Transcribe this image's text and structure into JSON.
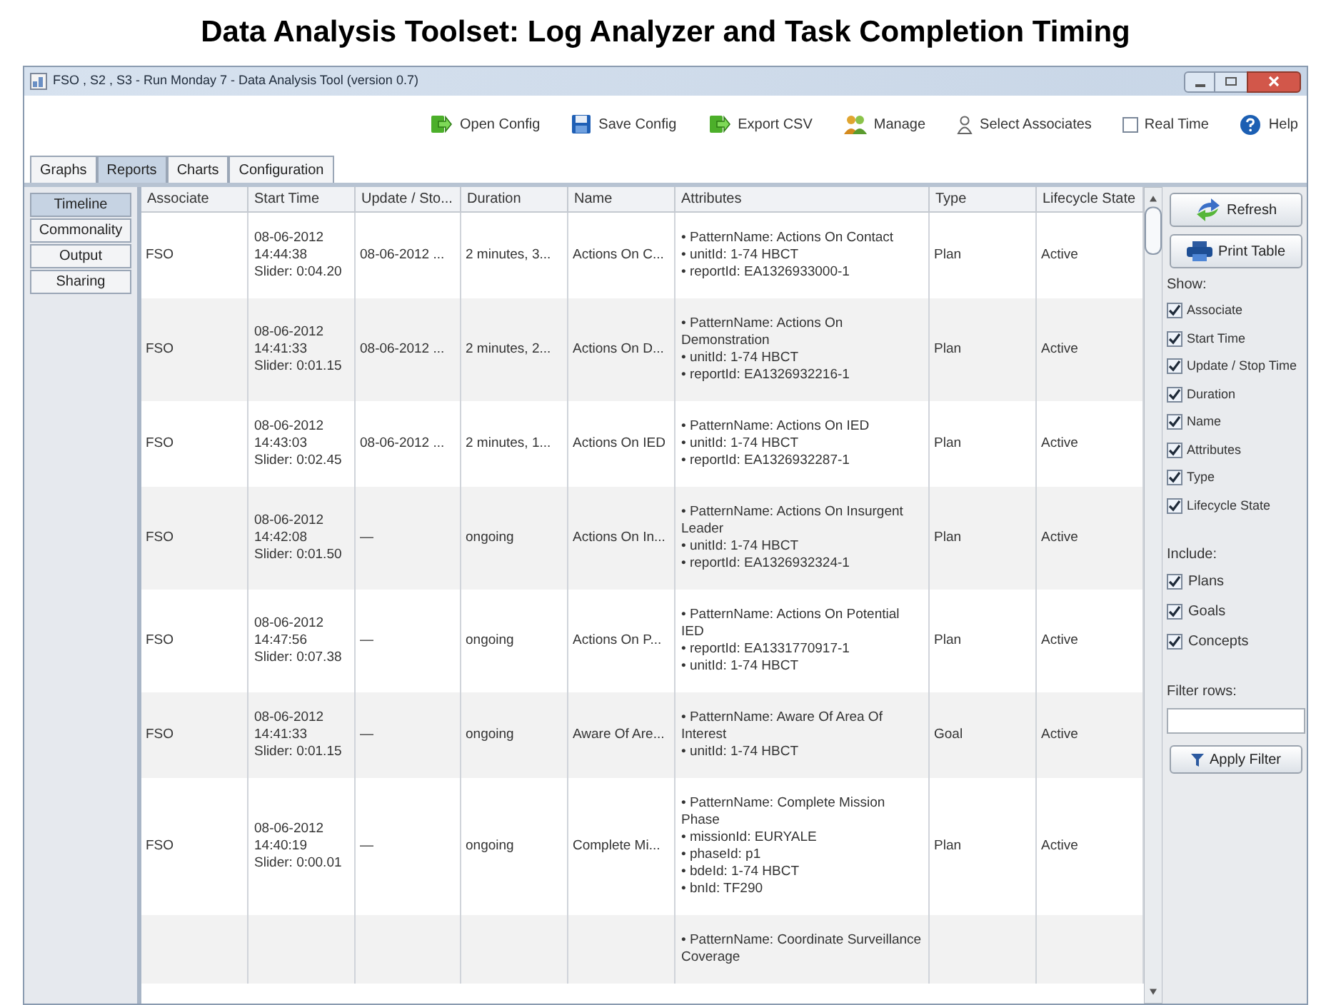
{
  "page_title": "Data Analysis Toolset: Log Analyzer and Task Completion Timing",
  "window": {
    "title": "FSO , S2 , S3 - Run Monday 7 - Data Analysis Tool (version 0.7)"
  },
  "toolbar": [
    {
      "kind": "open",
      "label": "Open Config"
    },
    {
      "kind": "save",
      "label": "Save Config"
    },
    {
      "kind": "export",
      "label": "Export CSV"
    },
    {
      "kind": "manage",
      "label": "Manage"
    },
    {
      "kind": "associates",
      "label": "Select Associates"
    },
    {
      "kind": "checkbox",
      "label": "Real Time",
      "checked": false
    },
    {
      "kind": "help",
      "label": "Help"
    }
  ],
  "tabs": [
    {
      "label": "Graphs",
      "selected": false
    },
    {
      "label": "Reports",
      "selected": true
    },
    {
      "label": "Charts",
      "selected": false
    },
    {
      "label": "Configuration",
      "selected": false
    }
  ],
  "side_tabs": [
    {
      "label": "Timeline",
      "selected": true
    },
    {
      "label": "Commonality",
      "selected": false
    },
    {
      "label": "Output",
      "selected": false
    },
    {
      "label": "Sharing",
      "selected": false
    }
  ],
  "table": {
    "columns": [
      "Associate",
      "Start Time",
      "Update / Sto...",
      "Duration",
      "Name",
      "Attributes",
      "Type",
      "Lifecycle State"
    ],
    "rows": [
      {
        "associate": "FSO",
        "start_time": [
          "08-06-2012",
          "14:44:38",
          "Slider: 0:04.20"
        ],
        "update": "08-06-2012 ...",
        "duration": "2 minutes, 3...",
        "name": "Actions On C...",
        "attributes": [
          "• PatternName: Actions On Contact",
          "• unitId: 1-74 HBCT",
          "• reportId: EA1326933000-1"
        ],
        "type": "Plan",
        "state": "Active"
      },
      {
        "associate": "FSO",
        "start_time": [
          "08-06-2012",
          "14:41:33",
          "Slider: 0:01.15"
        ],
        "update": "08-06-2012 ...",
        "duration": "2 minutes, 2...",
        "name": "Actions On D...",
        "attributes": [
          "• PatternName: Actions On Demonstration",
          "• unitId: 1-74 HBCT",
          "• reportId: EA1326932216-1"
        ],
        "type": "Plan",
        "state": "Active"
      },
      {
        "associate": "FSO",
        "start_time": [
          "08-06-2012",
          "14:43:03",
          "Slider: 0:02.45"
        ],
        "update": "08-06-2012 ...",
        "duration": "2 minutes, 1...",
        "name": "Actions On IED",
        "attributes": [
          "• PatternName: Actions On IED",
          "• unitId: 1-74 HBCT",
          "• reportId: EA1326932287-1"
        ],
        "type": "Plan",
        "state": "Active"
      },
      {
        "associate": "FSO",
        "start_time": [
          "08-06-2012",
          "14:42:08",
          "Slider: 0:01.50"
        ],
        "update": "—",
        "duration": "ongoing",
        "name": "Actions On In...",
        "attributes": [
          "• PatternName: Actions On Insurgent Leader",
          "• unitId: 1-74 HBCT",
          "• reportId: EA1326932324-1"
        ],
        "type": "Plan",
        "state": "Active"
      },
      {
        "associate": "FSO",
        "start_time": [
          "08-06-2012",
          "14:47:56",
          "Slider: 0:07.38"
        ],
        "update": "—",
        "duration": "ongoing",
        "name": "Actions On P...",
        "attributes": [
          "• PatternName: Actions On Potential IED",
          "• reportId: EA1331770917-1",
          "• unitId: 1-74 HBCT"
        ],
        "type": "Plan",
        "state": "Active"
      },
      {
        "associate": "FSO",
        "start_time": [
          "08-06-2012",
          "14:41:33",
          "Slider: 0:01.15"
        ],
        "update": "—",
        "duration": "ongoing",
        "name": "Aware Of Are...",
        "attributes": [
          "• PatternName: Aware Of Area Of Interest",
          "• unitId: 1-74 HBCT"
        ],
        "type": "Goal",
        "state": "Active"
      },
      {
        "associate": "FSO",
        "start_time": [
          "08-06-2012",
          "14:40:19",
          "Slider: 0:00.01"
        ],
        "update": "—",
        "duration": "ongoing",
        "name": "Complete Mi...",
        "attributes": [
          "• PatternName: Complete Mission Phase",
          "• missionId: EURYALE",
          "• phaseId: p1",
          "• bdeId: 1-74 HBCT",
          "• bnId: TF290"
        ],
        "type": "Plan",
        "state": "Active"
      },
      {
        "attributes": [
          "• PatternName: Coordinate Surveillance Coverage"
        ]
      }
    ]
  },
  "side_panel": {
    "refresh": "Refresh",
    "print": "Print Table",
    "show_label": "Show:",
    "show": [
      {
        "label": "Associate",
        "checked": true
      },
      {
        "label": "Start Time",
        "checked": true
      },
      {
        "label": "Update / Stop Time",
        "checked": true
      },
      {
        "label": "Duration",
        "checked": true
      },
      {
        "label": "Name",
        "checked": true
      },
      {
        "label": "Attributes",
        "checked": true
      },
      {
        "label": "Type",
        "checked": true
      },
      {
        "label": "Lifecycle State",
        "checked": true
      }
    ],
    "include_label": "Include:",
    "include": [
      {
        "label": "Plans",
        "checked": true
      },
      {
        "label": "Goals",
        "checked": true
      },
      {
        "label": "Concepts",
        "checked": true
      }
    ],
    "filter_label": "Filter rows:",
    "apply": "Apply Filter"
  }
}
